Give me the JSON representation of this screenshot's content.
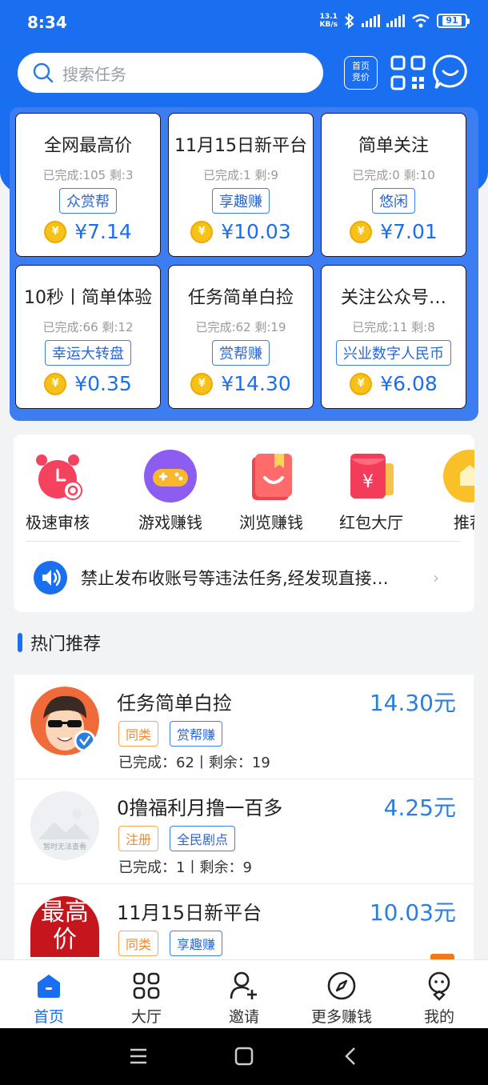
{
  "status_bar": {
    "time": "8:34",
    "speed_value": "13.1",
    "speed_unit": "KB/s",
    "battery": "91"
  },
  "header": {
    "search_placeholder": "搜索任务",
    "bid_label": "首页\n竞价"
  },
  "task_cards": [
    {
      "title": "全网最高价",
      "stats": "已完成:105 剩:3",
      "tag": "众赏帮",
      "price": "¥7.14"
    },
    {
      "title": "11月15日新平台",
      "stats": "已完成:1 剩:9",
      "tag": "享趣赚",
      "price": "¥10.03"
    },
    {
      "title": "简单关注",
      "stats": "已完成:0 剩:10",
      "tag": "悠闲",
      "price": "¥7.01"
    },
    {
      "title": "10秒丨简单体验",
      "stats": "已完成:66 剩:12",
      "tag": "幸运大转盘",
      "price": "¥0.35"
    },
    {
      "title": "任务简单白捡",
      "stats": "已完成:62 剩:19",
      "tag": "赏帮赚",
      "price": "¥14.30"
    },
    {
      "title": "关注公众号…",
      "stats": "已完成:11 剩:8",
      "tag": "兴业数字人民币",
      "price": "¥6.08"
    }
  ],
  "categories": [
    {
      "label": "极速审核",
      "icon": "alarm-clock-icon"
    },
    {
      "label": "游戏赚钱",
      "icon": "gamepad-icon"
    },
    {
      "label": "浏览赚钱",
      "icon": "smile-book-icon"
    },
    {
      "label": "红包大厅",
      "icon": "red-envelope-icon"
    },
    {
      "label": "推荐",
      "icon": "recommend-icon"
    }
  ],
  "notice": {
    "text": "禁止发布收账号等违法任务,经发现直接…"
  },
  "section": {
    "title": "热门推荐"
  },
  "list": [
    {
      "title": "任务简单白捡",
      "price": "14.30元",
      "tags": [
        "同类",
        "赏帮赚"
      ],
      "stats": "已完成：62丨剩余：19"
    },
    {
      "title": "0撸福利月撸一百多",
      "price": "4.25元",
      "tags": [
        "注册",
        "全民剧点"
      ],
      "stats": "已完成：1丨剩余：9",
      "avatar_text": "暂时无法查看"
    },
    {
      "title": "11月15日新平台",
      "price": "10.03元",
      "tags": [
        "同类",
        "享趣赚"
      ],
      "stats": "",
      "avatar_text": "最高价"
    }
  ],
  "nav": [
    {
      "label": "首页",
      "icon": "home-icon"
    },
    {
      "label": "大厅",
      "icon": "grid-icon"
    },
    {
      "label": "邀请",
      "icon": "add-user-icon"
    },
    {
      "label": "更多赚钱",
      "icon": "compass-icon"
    },
    {
      "label": "我的",
      "icon": "profile-icon"
    }
  ],
  "colors": {
    "brand": "#1a6ff0",
    "price": "#2a7de1",
    "tag_orange": "#ef8a2d"
  }
}
